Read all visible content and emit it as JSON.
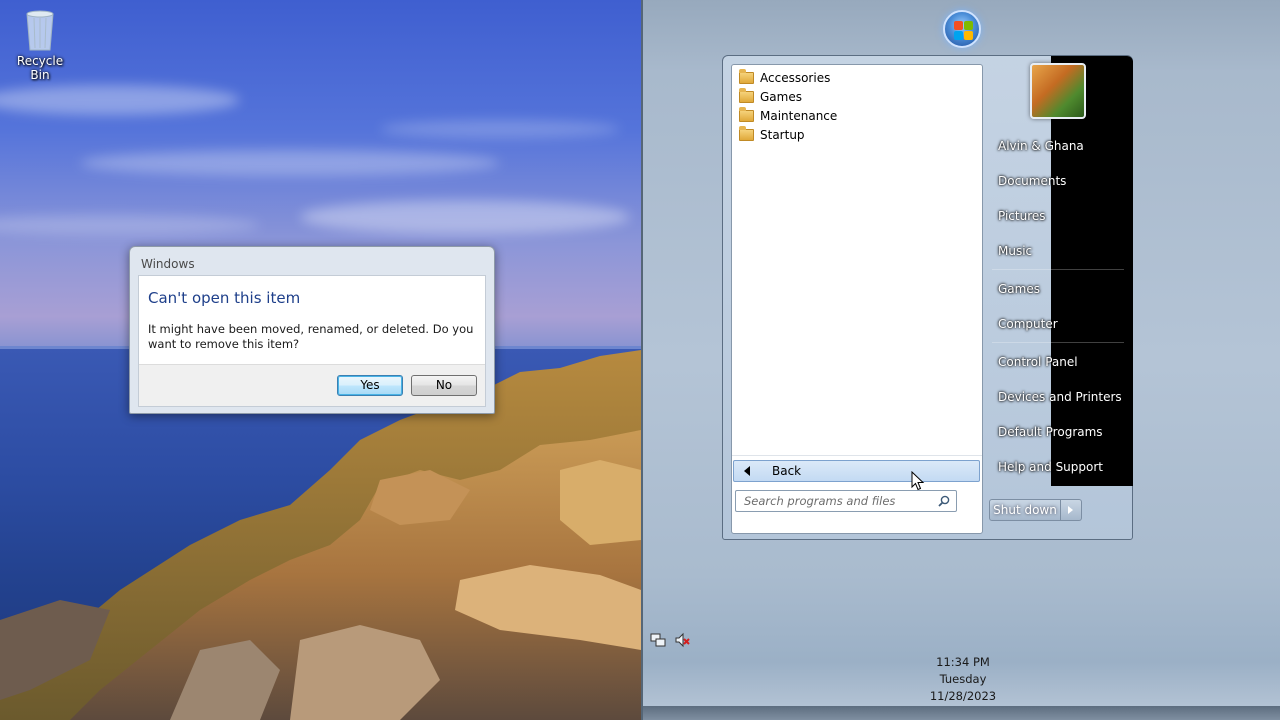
{
  "desktop": {
    "recycle_bin_label": "Recycle Bin"
  },
  "dialog": {
    "title": "Windows",
    "heading": "Can't open this item",
    "message": "It might have been moved, renamed, or deleted. Do you want to remove this item?",
    "yes_label": "Yes",
    "no_label": "No"
  },
  "start_menu": {
    "programs": [
      {
        "label": "Accessories",
        "icon": "folder-icon"
      },
      {
        "label": "Games",
        "icon": "folder-icon"
      },
      {
        "label": "Maintenance",
        "icon": "folder-icon"
      },
      {
        "label": "Startup",
        "icon": "folder-icon"
      }
    ],
    "back_label": "Back",
    "search_placeholder": "Search programs and files",
    "right_items": [
      "Alvin & Ghana",
      "Documents",
      "Pictures",
      "Music",
      "Games",
      "Computer",
      "Control Panel",
      "Devices and Printers",
      "Default Programs",
      "Help and Support"
    ],
    "shutdown_label": "Shut down"
  },
  "clock": {
    "time": "11:34 PM",
    "day": "Tuesday",
    "date": "11/28/2023"
  },
  "colors": {
    "dialog_heading": "#1e3f8a",
    "default_button_border": "#3c7fb1"
  }
}
